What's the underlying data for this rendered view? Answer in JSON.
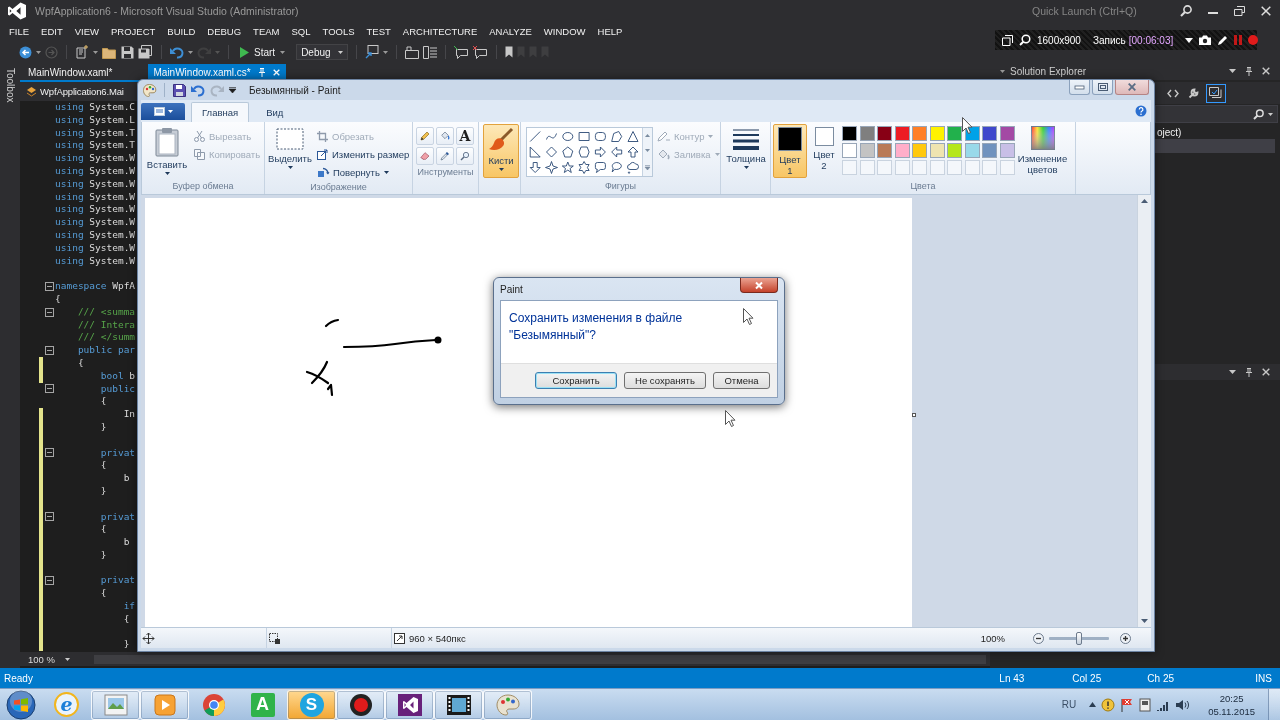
{
  "vs_window": {
    "title": "WpfApplication6 - Microsoft Visual Studio (Administrator)",
    "quick_launch": {
      "placeholder": "Quick Launch (Ctrl+Q)"
    },
    "menu": [
      "FILE",
      "EDIT",
      "VIEW",
      "PROJECT",
      "BUILD",
      "DEBUG",
      "TEAM",
      "SQL",
      "TOOLS",
      "TEST",
      "ARCHITECTURE",
      "ANALYZE",
      "WINDOW",
      "HELP"
    ],
    "toolbar": {
      "start_button": "Start",
      "configuration": "Debug"
    },
    "toolbox_tab": "Toolbox",
    "document_tabs": [
      {
        "label": "MainWindow.xaml*",
        "selected": false
      },
      {
        "label": "MainWindow.xaml.cs*",
        "selected": true
      }
    ],
    "navigation_bar": "WpfApplication6.Mai",
    "editor": {
      "lines": [
        {
          "kind": "code",
          "changed": false,
          "foldable": false,
          "tokens": [
            {
              "kind": "keyword",
              "text": "using"
            },
            {
              "kind": "plain",
              "text": " System.C"
            }
          ]
        },
        {
          "kind": "code",
          "changed": false,
          "foldable": false,
          "tokens": [
            {
              "kind": "keyword",
              "text": "using"
            },
            {
              "kind": "plain",
              "text": " System.L"
            }
          ]
        },
        {
          "kind": "code",
          "changed": false,
          "foldable": false,
          "tokens": [
            {
              "kind": "keyword",
              "text": "using"
            },
            {
              "kind": "plain",
              "text": " System.T"
            }
          ]
        },
        {
          "kind": "code",
          "changed": false,
          "foldable": false,
          "tokens": [
            {
              "kind": "keyword",
              "text": "using"
            },
            {
              "kind": "plain",
              "text": " System.T"
            }
          ]
        },
        {
          "kind": "code",
          "changed": false,
          "foldable": false,
          "tokens": [
            {
              "kind": "keyword",
              "text": "using"
            },
            {
              "kind": "plain",
              "text": " System.W"
            }
          ]
        },
        {
          "kind": "code",
          "changed": false,
          "foldable": false,
          "tokens": [
            {
              "kind": "keyword",
              "text": "using"
            },
            {
              "kind": "plain",
              "text": " System.W"
            }
          ]
        },
        {
          "kind": "code",
          "changed": false,
          "foldable": false,
          "tokens": [
            {
              "kind": "keyword",
              "text": "using"
            },
            {
              "kind": "plain",
              "text": " System.W"
            }
          ]
        },
        {
          "kind": "code",
          "changed": false,
          "foldable": false,
          "tokens": [
            {
              "kind": "keyword",
              "text": "using"
            },
            {
              "kind": "plain",
              "text": " System.W"
            }
          ]
        },
        {
          "kind": "code",
          "changed": false,
          "foldable": false,
          "tokens": [
            {
              "kind": "keyword",
              "text": "using"
            },
            {
              "kind": "plain",
              "text": " System.W"
            }
          ]
        },
        {
          "kind": "code",
          "changed": false,
          "foldable": false,
          "tokens": [
            {
              "kind": "keyword",
              "text": "using"
            },
            {
              "kind": "plain",
              "text": " System.W"
            }
          ]
        },
        {
          "kind": "code",
          "changed": false,
          "foldable": false,
          "tokens": [
            {
              "kind": "keyword",
              "text": "using"
            },
            {
              "kind": "plain",
              "text": " System.W"
            }
          ]
        },
        {
          "kind": "code",
          "changed": false,
          "foldable": false,
          "tokens": [
            {
              "kind": "keyword",
              "text": "using"
            },
            {
              "kind": "plain",
              "text": " System.W"
            }
          ]
        },
        {
          "kind": "code",
          "changed": false,
          "foldable": false,
          "tokens": [
            {
              "kind": "keyword",
              "text": "using"
            },
            {
              "kind": "plain",
              "text": " System.W"
            }
          ]
        },
        {
          "kind": "blank",
          "changed": false,
          "foldable": false
        },
        {
          "kind": "code",
          "changed": false,
          "foldable": true,
          "tokens": [
            {
              "kind": "keyword",
              "text": "namespace"
            },
            {
              "kind": "plain",
              "text": " WpfA"
            }
          ]
        },
        {
          "kind": "code",
          "changed": false,
          "foldable": false,
          "tokens": [
            {
              "kind": "plain",
              "text": "{"
            }
          ]
        },
        {
          "kind": "code",
          "changed": false,
          "foldable": true,
          "tokens": [
            {
              "kind": "comment",
              "text": "    /// <summa"
            }
          ]
        },
        {
          "kind": "code",
          "changed": false,
          "foldable": false,
          "tokens": [
            {
              "kind": "comment",
              "text": "    /// Intera"
            }
          ]
        },
        {
          "kind": "code",
          "changed": false,
          "foldable": false,
          "tokens": [
            {
              "kind": "comment",
              "text": "    /// </summ"
            }
          ]
        },
        {
          "kind": "code",
          "changed": false,
          "foldable": true,
          "tokens": [
            {
              "kind": "keyword",
              "text": "    public par"
            }
          ]
        },
        {
          "kind": "code",
          "changed": true,
          "foldable": false,
          "tokens": [
            {
              "kind": "plain",
              "text": "    {"
            }
          ]
        },
        {
          "kind": "code",
          "changed": true,
          "foldable": false,
          "tokens": [
            {
              "kind": "keyword",
              "text": "        bool"
            },
            {
              "kind": "plain",
              "text": " b"
            }
          ]
        },
        {
          "kind": "code",
          "changed": false,
          "foldable": true,
          "tokens": [
            {
              "kind": "keyword",
              "text": "        public"
            }
          ]
        },
        {
          "kind": "code",
          "changed": false,
          "foldable": false,
          "tokens": [
            {
              "kind": "plain",
              "text": "        {"
            }
          ]
        },
        {
          "kind": "code",
          "changed": true,
          "foldable": false,
          "tokens": [
            {
              "kind": "plain",
              "text": "            In"
            }
          ]
        },
        {
          "kind": "code",
          "changed": true,
          "foldable": false,
          "tokens": [
            {
              "kind": "plain",
              "text": "        }"
            }
          ]
        },
        {
          "kind": "blank",
          "changed": true,
          "foldable": false
        },
        {
          "kind": "code",
          "changed": true,
          "foldable": true,
          "tokens": [
            {
              "kind": "keyword",
              "text": "        privat"
            }
          ]
        },
        {
          "kind": "code",
          "changed": true,
          "foldable": false,
          "tokens": [
            {
              "kind": "plain",
              "text": "        {"
            }
          ]
        },
        {
          "kind": "code",
          "changed": true,
          "foldable": false,
          "tokens": [
            {
              "kind": "plain",
              "text": "            b"
            }
          ]
        },
        {
          "kind": "code",
          "changed": true,
          "foldable": false,
          "tokens": [
            {
              "kind": "plain",
              "text": "        }"
            }
          ]
        },
        {
          "kind": "blank",
          "changed": true,
          "foldable": false
        },
        {
          "kind": "code",
          "changed": true,
          "foldable": true,
          "tokens": [
            {
              "kind": "keyword",
              "text": "        privat"
            }
          ]
        },
        {
          "kind": "code",
          "changed": true,
          "foldable": false,
          "tokens": [
            {
              "kind": "plain",
              "text": "        {"
            }
          ]
        },
        {
          "kind": "code",
          "changed": true,
          "foldable": false,
          "tokens": [
            {
              "kind": "plain",
              "text": "            b"
            }
          ]
        },
        {
          "kind": "code",
          "changed": true,
          "foldable": false,
          "tokens": [
            {
              "kind": "plain",
              "text": "        }"
            }
          ]
        },
        {
          "kind": "blank",
          "changed": true,
          "foldable": false
        },
        {
          "kind": "code",
          "changed": true,
          "foldable": true,
          "tokens": [
            {
              "kind": "keyword",
              "text": "        privat"
            }
          ]
        },
        {
          "kind": "code",
          "changed": true,
          "foldable": false,
          "tokens": [
            {
              "kind": "plain",
              "text": "        {"
            }
          ]
        },
        {
          "kind": "code",
          "changed": true,
          "foldable": false,
          "tokens": [
            {
              "kind": "keyword",
              "text": "            if"
            }
          ]
        },
        {
          "kind": "code",
          "changed": true,
          "foldable": false,
          "tokens": [
            {
              "kind": "plain",
              "text": "            {"
            }
          ]
        },
        {
          "kind": "blank",
          "changed": true,
          "foldable": false
        },
        {
          "kind": "code",
          "changed": true,
          "foldable": false,
          "tokens": [
            {
              "kind": "plain",
              "text": "            }"
            }
          ]
        }
      ],
      "zoom": "100 %"
    },
    "solution_explorer": {
      "title": "Solution Explorer",
      "tree": [
        {
          "label": "oject)",
          "selected": false
        },
        {
          "selected": true
        }
      ]
    },
    "status_bar": {
      "state": "Ready",
      "line": "Ln 43",
      "column": "Col 25",
      "character": "Ch 25",
      "mode": "INS"
    }
  },
  "recorder_bar": {
    "resolution": "1600x900",
    "label": "Запись",
    "time": "[00:06:03]"
  },
  "paint_window": {
    "title": "Безымянный - Paint",
    "ribbon": {
      "tabs": [
        {
          "label": "Главная",
          "selected": true
        },
        {
          "label": "Вид",
          "selected": false
        }
      ],
      "groups": [
        {
          "kind": "clipboard",
          "label": "Буфер обмена",
          "main_button": "Вставить",
          "items": [
            {
              "label": "Вырезать",
              "disabled": true
            },
            {
              "label": "Копировать",
              "disabled": true
            }
          ]
        },
        {
          "kind": "image",
          "label": "Изображение",
          "main_button": "Выделить",
          "items": [
            {
              "label": "Обрезать",
              "disabled": true
            },
            {
              "label": "Изменить размер",
              "disabled": false
            },
            {
              "label": "Повернуть",
              "disabled": false
            }
          ]
        },
        {
          "kind": "tools",
          "label": "Инструменты",
          "text_tool": "A"
        },
        {
          "kind": "brushes",
          "main_button": "Кисти",
          "selected": true
        },
        {
          "kind": "shapes",
          "label": "Фигуры",
          "items": [
            {
              "label": "Контур",
              "disabled": true
            },
            {
              "label": "Заливка",
              "disabled": true
            }
          ]
        },
        {
          "kind": "size",
          "main_button": "Толщина"
        },
        {
          "kind": "colors",
          "label": "Цвета",
          "color_buttons": [
            {
              "label": "Цвет 1",
              "selected": true,
              "color": "#000000"
            },
            {
              "label": "Цвет 2",
              "selected": false,
              "color": "#ffffff"
            }
          ],
          "palette": [
            {
              "kind": "swatch",
              "color": "#000000"
            },
            {
              "kind": "swatch",
              "color": "#7f7f7f"
            },
            {
              "kind": "swatch",
              "color": "#880015"
            },
            {
              "kind": "swatch",
              "color": "#ed1c24"
            },
            {
              "kind": "swatch",
              "color": "#ff7f27"
            },
            {
              "kind": "swatch",
              "color": "#fff200"
            },
            {
              "kind": "swatch",
              "color": "#22b14c"
            },
            {
              "kind": "swatch",
              "color": "#00a2e8"
            },
            {
              "kind": "swatch",
              "color": "#3f48cc"
            },
            {
              "kind": "swatch",
              "color": "#a349a4"
            },
            {
              "kind": "swatch",
              "color": "#ffffff"
            },
            {
              "kind": "swatch",
              "color": "#c3c3c3"
            },
            {
              "kind": "swatch",
              "color": "#b97a57"
            },
            {
              "kind": "swatch",
              "color": "#ffaec9"
            },
            {
              "kind": "swatch",
              "color": "#ffc90e"
            },
            {
              "kind": "swatch",
              "color": "#efe4b0"
            },
            {
              "kind": "swatch",
              "color": "#b5e61d"
            },
            {
              "kind": "swatch",
              "color": "#99d9ea"
            },
            {
              "kind": "swatch",
              "color": "#7092be"
            },
            {
              "kind": "swatch",
              "color": "#c8bfe7"
            },
            {
              "kind": "empty"
            },
            {
              "kind": "empty"
            },
            {
              "kind": "empty"
            },
            {
              "kind": "empty"
            },
            {
              "kind": "empty"
            },
            {
              "kind": "empty"
            },
            {
              "kind": "empty"
            },
            {
              "kind": "empty"
            },
            {
              "kind": "empty"
            },
            {
              "kind": "empty"
            }
          ],
          "edit_button": "Изменение цветов"
        }
      ]
    },
    "status_bar": {
      "canvas_size": "960 × 540пкс",
      "zoom": "100%",
      "zoom_slider": {
        "level": 0.5
      }
    }
  },
  "dialog": {
    "title": "Paint",
    "message": "Сохранить изменения в файле \"Безымянный\"?",
    "buttons": [
      {
        "label": "Сохранить",
        "default": true
      },
      {
        "label": "Не сохранять",
        "default": false
      },
      {
        "label": "Отмена",
        "default": false
      }
    ]
  },
  "taskbar": {
    "apps": [
      {
        "kind": "ring",
        "glyph": "e",
        "running": false,
        "flashing": false
      },
      {
        "kind": "picture",
        "running": true,
        "flashing": false
      },
      {
        "kind": "player",
        "running": true,
        "flashing": false
      },
      {
        "kind": "chrome",
        "running": false,
        "flashing": false
      },
      {
        "kind": "tile",
        "glyph": "A",
        "running": false,
        "flashing": false
      },
      {
        "kind": "disc",
        "glyph": "S",
        "running": true,
        "flashing": true
      },
      {
        "kind": "record",
        "running": true,
        "flashing": false
      },
      {
        "kind": "studio",
        "running": true,
        "flashing": false
      },
      {
        "kind": "film",
        "running": true,
        "flashing": false
      },
      {
        "kind": "palette",
        "running": true,
        "flashing": false
      }
    ],
    "tray": {
      "language": "RU",
      "time": "20:25",
      "date": "05.11.2015"
    }
  }
}
